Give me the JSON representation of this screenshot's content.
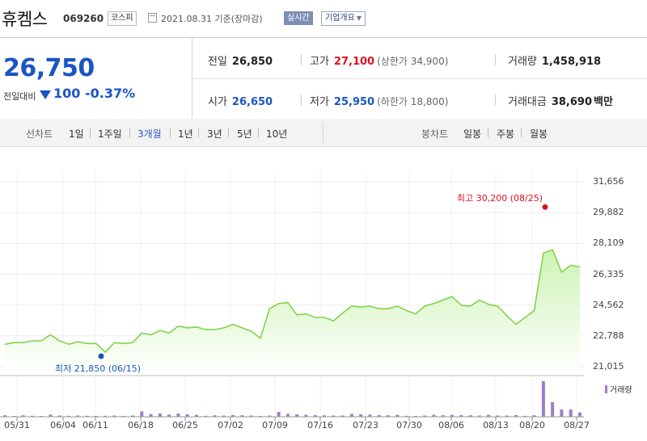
{
  "header": {
    "name": "휴켐스",
    "code": "069260",
    "market": "코스피",
    "date": "2021.08.31",
    "date_note": "기준(장마감)",
    "realtime_label": "실시간",
    "company_label": "기업개요"
  },
  "summary": {
    "price": "26,750",
    "change_label": "전일대비",
    "change_value": "100",
    "change_pct": "-0.37%",
    "prev_close": {
      "label": "전일",
      "value": "26,850"
    },
    "high": {
      "label": "고가",
      "value": "27,100",
      "note": "(상한가 34,900)"
    },
    "volume": {
      "label": "거래량",
      "value": "1,458,918"
    },
    "open": {
      "label": "시가",
      "value": "26,650"
    },
    "low": {
      "label": "저가",
      "value": "25,950",
      "note": "(하한가 18,800)"
    },
    "amount": {
      "label": "거래대금",
      "value": "38,690",
      "unit": "백만"
    }
  },
  "periods": {
    "line_label": "선차트",
    "line_items": [
      "1일",
      "1주일",
      "3개월",
      "1년",
      "3년",
      "5년",
      "10년"
    ],
    "selected": "3개월",
    "candle_label": "봉차트",
    "candle_items": [
      "일봉",
      "주봉",
      "월봉"
    ]
  },
  "colors": {
    "price_line": "#7fd44a",
    "price_fill_top": "#cdf3b4",
    "price_fill_bottom": "#ffffff",
    "volume_bar": "#9b7fca",
    "high_marker": "#e0111d",
    "low_marker": "#1a55c4"
  },
  "chart_data": {
    "type": "area",
    "y_ticks": [
      "31,656",
      "29,882",
      "28,109",
      "26,335",
      "24,562",
      "22,788",
      "21,015"
    ],
    "ylim": [
      21015,
      31656
    ],
    "x_ticks": [
      "05/31",
      "06/04",
      "06/11",
      "06/18",
      "06/25",
      "07/02",
      "07/09",
      "07/16",
      "07/23",
      "07/30",
      "08/06",
      "08/13",
      "08/20",
      "08/27"
    ],
    "annotations": {
      "high": {
        "label": "최고 30,200 (08/25)",
        "value": 30200
      },
      "low": {
        "label": "최저 21,850 (06/15)",
        "value": 21850
      }
    },
    "volume_legend": "거래량",
    "series": [
      {
        "values": [
          22300,
          22400,
          22400,
          22500,
          22500,
          22850,
          22500,
          22300,
          22450,
          22350,
          22350,
          21850,
          22400,
          22350,
          22400,
          22950,
          22850,
          23100,
          22950,
          23350,
          23250,
          23300,
          23150,
          23150,
          23250,
          23450,
          23250,
          23050,
          22650,
          24350,
          24650,
          24700,
          24000,
          24050,
          23850,
          23850,
          23650,
          24100,
          24500,
          24450,
          24500,
          24350,
          24350,
          24500,
          24250,
          24050,
          24500,
          24650,
          24850,
          25050,
          24550,
          24500,
          24850,
          24600,
          24500,
          23950,
          23450,
          23850,
          24250,
          27550,
          27750,
          26450,
          26850,
          26750
        ]
      },
      {
        "values": [
          0.6,
          0.3,
          0.6,
          0.4,
          0.3,
          0.9,
          0.5,
          0.4,
          0.5,
          0.4,
          0.3,
          0.4,
          0.5,
          0.3,
          0.5,
          2.2,
          1.1,
          1.4,
          0.9,
          1.3,
          1.0,
          0.8,
          0.4,
          0.6,
          0.5,
          0.7,
          0.6,
          0.5,
          0.3,
          0.5,
          2.0,
          1.2,
          1.0,
          0.8,
          0.7,
          0.6,
          0.5,
          0.5,
          1.2,
          1.0,
          0.9,
          0.7,
          0.6,
          0.8,
          0.4,
          0.3,
          0.5,
          0.8,
          0.6,
          0.8,
          0.7,
          0.6,
          0.5,
          0.8,
          0.5,
          0.5,
          0.7,
          0.4,
          0.6,
          14.6,
          6.0,
          3.0,
          3.0,
          1.8
        ]
      }
    ]
  }
}
